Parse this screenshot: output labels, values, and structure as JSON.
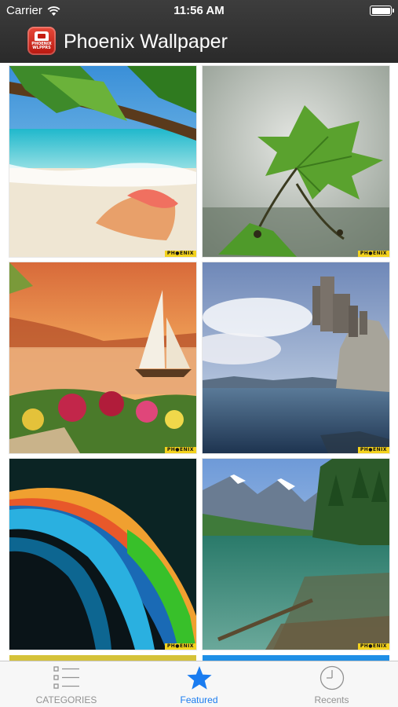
{
  "status_bar": {
    "carrier": "Carrier",
    "time": "11:56 AM",
    "battery_level": 1.0
  },
  "nav": {
    "title": "Phoenix Wallpaper",
    "logo_icon": "phoenix-wallpapers-app-icon",
    "logo_text_line1": "PHOENIX",
    "logo_text_line2": "WLPPRS"
  },
  "wallpapers": [
    {
      "subject": "tropical-beach-seashell",
      "watermark": "PH●ENIX"
    },
    {
      "subject": "green-leaf-branch",
      "watermark": "PH●ENIX"
    },
    {
      "subject": "sailboat-sunset-lake-flowers",
      "watermark": "PH●ENIX"
    },
    {
      "subject": "castle-cliff-sea",
      "watermark": "PH●ENIX"
    },
    {
      "subject": "abstract-color-waves",
      "watermark": "PH●ENIX"
    },
    {
      "subject": "mountain-lake-forest",
      "watermark": "PH●ENIX"
    }
  ],
  "tab_bar": {
    "tabs": [
      {
        "label": "CATEGORIES",
        "icon": "list-icon",
        "active": false
      },
      {
        "label": "Featured",
        "icon": "star-icon",
        "active": true
      },
      {
        "label": "Recents",
        "icon": "clock-icon",
        "active": false
      }
    ]
  },
  "colors": {
    "nav_background": "#333333",
    "tab_active": "#1a7cf0",
    "tab_inactive": "#929292",
    "watermark_yellow": "#f3d21d"
  }
}
